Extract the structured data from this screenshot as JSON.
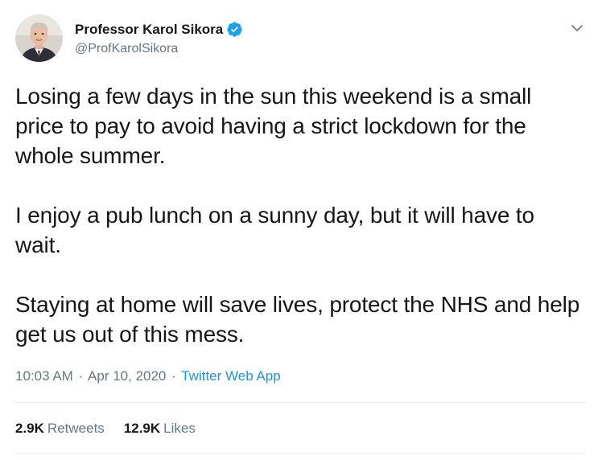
{
  "colors": {
    "verified_blue": "#1da1f2",
    "link_blue": "#1b95e0",
    "secondary_text": "#657786",
    "primary_text": "#14171a",
    "divider": "#e6ecf0"
  },
  "author": {
    "display_name": "Professor Karol Sikora",
    "handle": "@ProfKarolSikora",
    "verified_icon": "verified-badge-icon",
    "avatar": "profile-photo"
  },
  "menu": {
    "icon": "chevron-down-icon"
  },
  "tweet": {
    "paragraphs": [
      "Losing a few days in the sun this weekend is a small price to pay to avoid having a strict lockdown for the whole summer.",
      "I enjoy a pub lunch on a sunny day, but it will have to wait.",
      "Staying at home will save lives, protect the NHS and help get us out of this mess."
    ],
    "time": "10:03 AM",
    "date": "Apr 10, 2020",
    "separator": "·",
    "source": "Twitter Web App"
  },
  "stats": {
    "retweets_count": "2.9K",
    "retweets_label": "Retweets",
    "likes_count": "12.9K",
    "likes_label": "Likes"
  }
}
